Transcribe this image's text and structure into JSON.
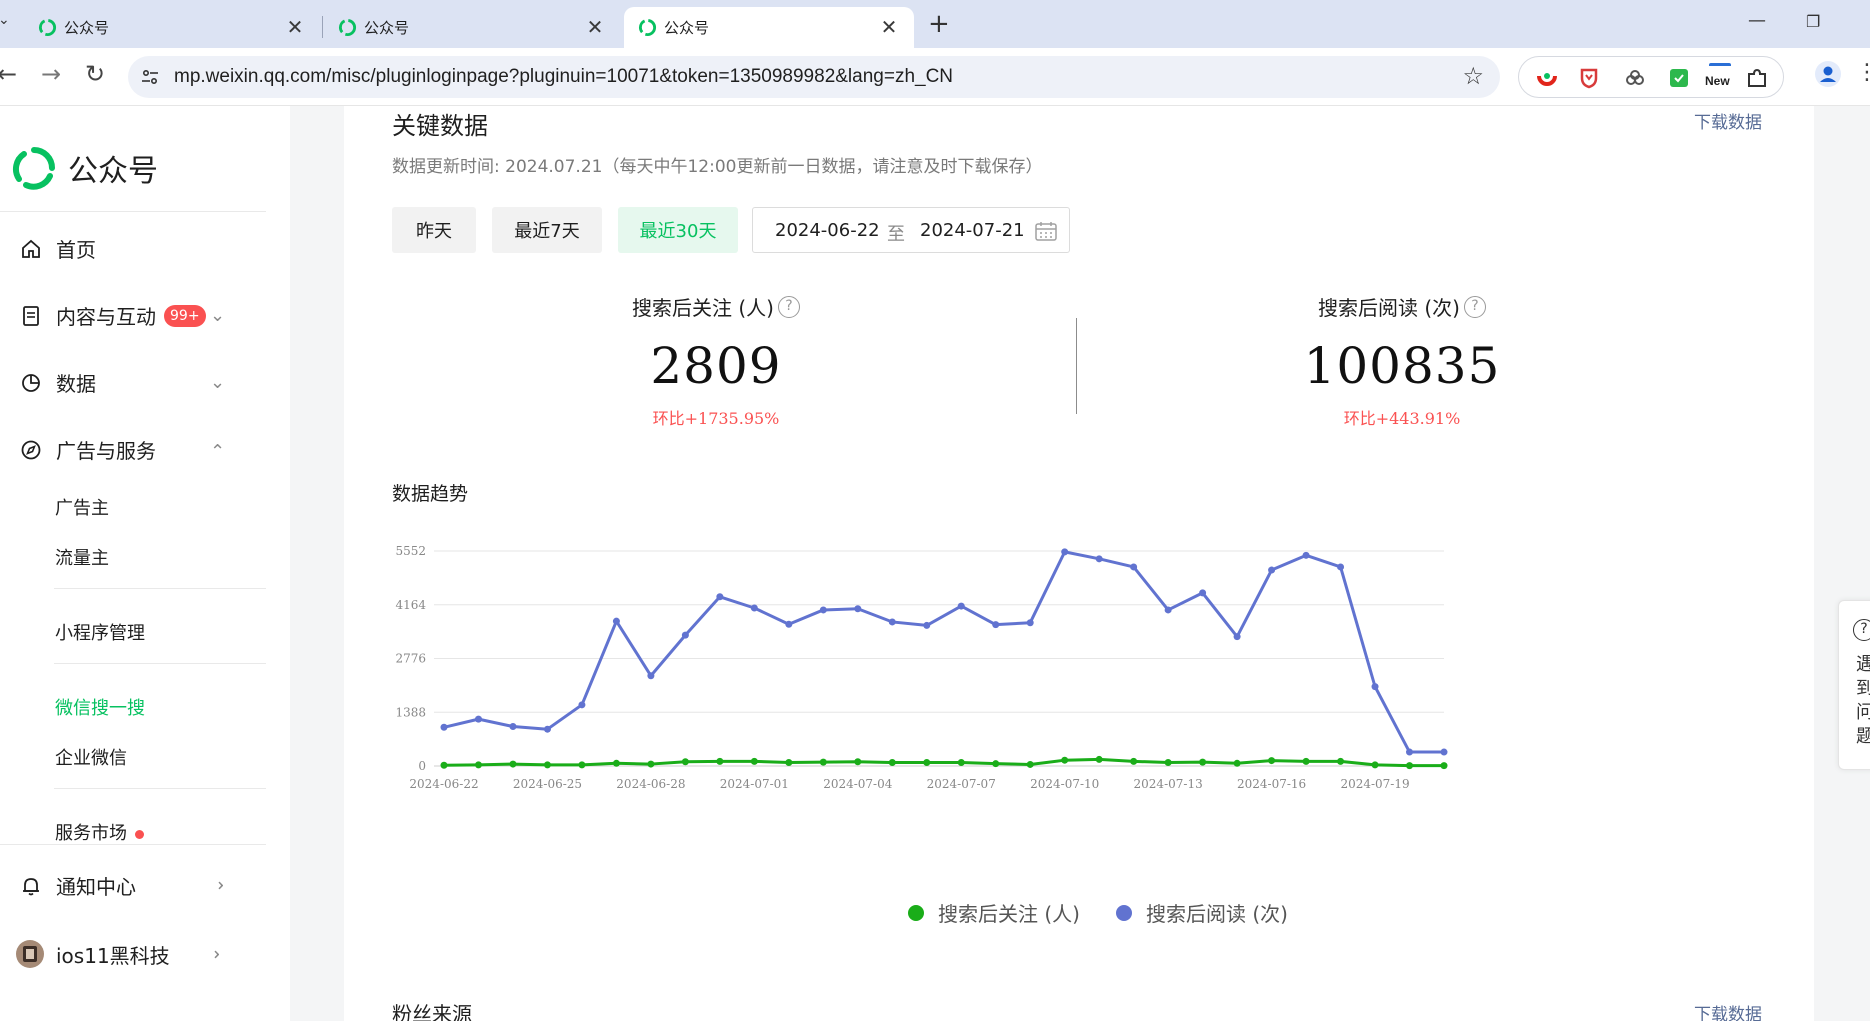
{
  "browser": {
    "tabs": [
      {
        "title": "公众号",
        "close": "✕"
      },
      {
        "title": "公众号",
        "close": "✕"
      },
      {
        "title": "公众号",
        "close": "✕"
      }
    ],
    "new_tab": "+",
    "url": "mp.weixin.qq.com/misc/pluginloginpage?pluginuin=10071&token=1350989982&lang=zh_CN",
    "extension_badge_text": "New"
  },
  "sidebar": {
    "logo_text": "公众号",
    "items": [
      {
        "label": "首页"
      },
      {
        "label": "内容与互动",
        "badge": "99+"
      },
      {
        "label": "数据"
      },
      {
        "label": "广告与服务"
      }
    ],
    "sub_items": [
      {
        "label": "广告主"
      },
      {
        "label": "流量主"
      },
      {
        "label": "小程序管理"
      },
      {
        "label": "微信搜一搜"
      },
      {
        "label": "企业微信"
      },
      {
        "label": "服务市场"
      }
    ],
    "bottom": [
      {
        "label": "通知中心"
      },
      {
        "label": "ios11黑科技"
      }
    ]
  },
  "main": {
    "title": "关键数据",
    "download_label": "下载数据",
    "update_note": "数据更新时间: 2024.07.21（每天中午12:00更新前一日数据，请注意及时下载保存）",
    "range_buttons": [
      "昨天",
      "最近7天",
      "最近30天"
    ],
    "active_range": "最近30天",
    "date_from": "2024-06-22",
    "date_sep": "至",
    "date_to": "2024-07-21",
    "kpis": [
      {
        "label": "搜索后关注 (人)",
        "value": "2809",
        "change": "环比+1735.95%"
      },
      {
        "label": "搜索后阅读 (次)",
        "value": "100835",
        "change": "环比+443.91%"
      }
    ],
    "chart_title": "数据趋势",
    "next_section_title": "粉丝来源",
    "next_download_label": "下载数据"
  },
  "help_widget": {
    "icon": "?",
    "text": "遇到问题"
  },
  "colors": {
    "brand_green": "#07c160",
    "follow_series": "#1aad19",
    "read_series": "#6173d0",
    "link": "#576b95",
    "negative": "#fa5151"
  },
  "chart_data": {
    "type": "line",
    "x": [
      "2024-06-22",
      "2024-06-23",
      "2024-06-24",
      "2024-06-25",
      "2024-06-26",
      "2024-06-27",
      "2024-06-28",
      "2024-06-29",
      "2024-06-30",
      "2024-07-01",
      "2024-07-02",
      "2024-07-03",
      "2024-07-04",
      "2024-07-05",
      "2024-07-06",
      "2024-07-07",
      "2024-07-08",
      "2024-07-09",
      "2024-07-10",
      "2024-07-11",
      "2024-07-12",
      "2024-07-13",
      "2024-07-14",
      "2024-07-15",
      "2024-07-16",
      "2024-07-17",
      "2024-07-18",
      "2024-07-19",
      "2024-07-20",
      "2024-07-21"
    ],
    "x_tick_labels": [
      "2024-06-22",
      "2024-06-25",
      "2024-06-28",
      "2024-07-01",
      "2024-07-04",
      "2024-07-07",
      "2024-07-10",
      "2024-07-13",
      "2024-07-16",
      "2024-07-19"
    ],
    "y_ticks": [
      0,
      1388,
      2776,
      4164,
      5552
    ],
    "ylim": [
      0,
      5552
    ],
    "grid": true,
    "legend_position": "bottom",
    "series": [
      {
        "name": "搜索后关注 (人)",
        "values": [
          20,
          30,
          50,
          30,
          30,
          70,
          50,
          110,
          120,
          120,
          90,
          100,
          110,
          90,
          90,
          90,
          60,
          40,
          150,
          170,
          120,
          90,
          100,
          70,
          140,
          120,
          120,
          30,
          10,
          10
        ]
      },
      {
        "name": "搜索后阅读 (次)",
        "values": [
          1000,
          1210,
          1020,
          950,
          1580,
          3740,
          2330,
          3380,
          4370,
          4080,
          3660,
          4030,
          4060,
          3720,
          3630,
          4130,
          3650,
          3700,
          5530,
          5350,
          5140,
          4030,
          4470,
          3340,
          5060,
          5440,
          5140,
          2050,
          360,
          360
        ]
      }
    ]
  }
}
